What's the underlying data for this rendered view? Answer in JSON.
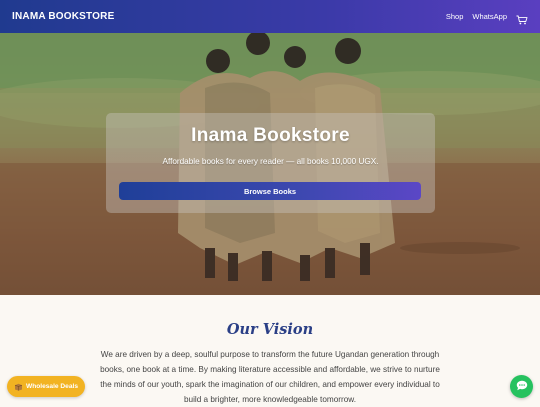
{
  "navbar": {
    "brand": "INAMA BOOKSTORE",
    "links": [
      "Shop",
      "WhatsApp"
    ],
    "cart_icon": "cart-icon"
  },
  "hero": {
    "title": "Inama Bookstore",
    "subtitle": "Affordable books for every reader — all books 10,000 UGX.",
    "cta": "Browse Books"
  },
  "vision": {
    "title": "Our Vision",
    "text": "We are driven by a deep, soulful purpose to transform the future Ugandan generation through books, one book at a time. By making literature accessible and affordable, we strive to nurture the minds of our youth, spark the imagination of our children, and empower every individual to build a brighter, more knowledgeable tomorrow."
  },
  "floating": {
    "wholesale_label": "Wholesale Deals",
    "wholesale_icon": "box-icon",
    "chat_icon": "chat-icon"
  },
  "colors": {
    "brand_gradient_start": "#203a8f",
    "brand_gradient_end": "#5a3fc0",
    "vision_title": "#2a3f86",
    "wholesale": "#f2b322",
    "chat": "#26c25f"
  }
}
